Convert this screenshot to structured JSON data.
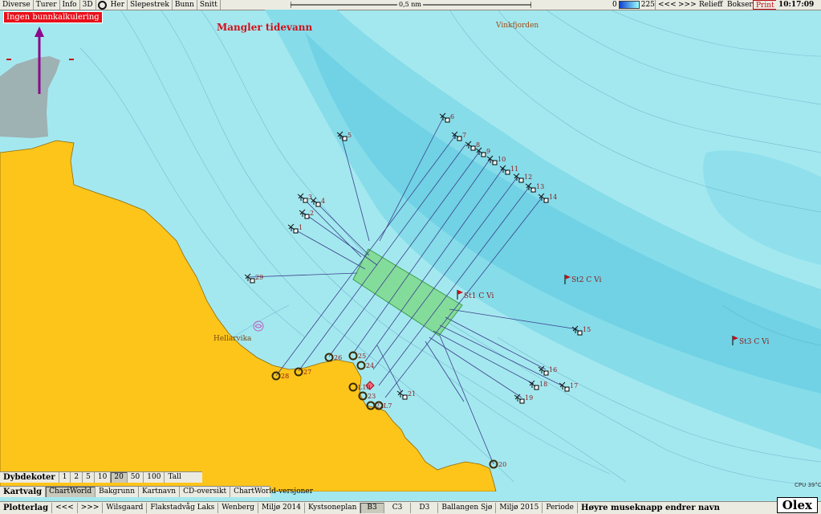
{
  "topbar": {
    "buttons": [
      "Diverse",
      "Turer",
      "Info",
      "3D",
      "Her",
      "Slepestrek",
      "Bunn",
      "Snitt"
    ],
    "scale_label": "0,5 nm",
    "depth_min": "0",
    "depth_max": "2250",
    "nav_back": "<<<",
    "nav_fwd": ">>>",
    "relieff": "Relieff",
    "bokser": "Bokser",
    "print": "Print",
    "clock": "10:17:09"
  },
  "map": {
    "warning_label": "Ingen bunnkalkulering",
    "tide_warning": "Mangler tidevann",
    "place_vinkfjorden": "Vinkfjorden",
    "place_hellarvika": "Hellarvika",
    "stations": [
      {
        "name": "St1 C Vi"
      },
      {
        "name": "St2 C Vi"
      },
      {
        "name": "St3 C Vi"
      }
    ],
    "marks": [
      "1",
      "2",
      "3",
      "4",
      "5",
      "6",
      "7",
      "8",
      "9",
      "10",
      "11",
      "12",
      "13",
      "14",
      "15",
      "16",
      "17",
      "18",
      "19",
      "20",
      "21",
      "22",
      "23",
      "24",
      "25",
      "26",
      "27",
      "28",
      "29",
      "L10",
      "L7"
    ],
    "cpu": "CPU 39°C"
  },
  "dybdekoter": {
    "title": "Dybdekoter",
    "options": [
      "1",
      "2",
      "5",
      "10",
      "20",
      "50",
      "100",
      "Tall"
    ],
    "selected": "20"
  },
  "kartvalg": {
    "title": "Kartvalg",
    "options": [
      "ChartWorld",
      "Bakgrunn",
      "Kartnavn",
      "CD-oversikt",
      "ChartWorld-versjoner"
    ],
    "selected": "ChartWorld"
  },
  "plotterlag": {
    "title": "Plotterlag",
    "nav_back": "<<<",
    "nav_fwd": ">>>",
    "options": [
      "Wilsgaard",
      "Flakstadvåg Laks",
      "Wenberg",
      "Miljø 2014",
      "Kystsoneplan",
      "B3",
      "C3",
      "D3",
      "Ballangen Sjø",
      "Miljø 2015",
      "Periode"
    ],
    "selected": "B3",
    "hint": "Høyre museknapp endrer navn"
  },
  "brand": "Olex",
  "colors": {
    "water": "#a4e8ef",
    "deep": "#6fd6e6",
    "land": "#fdc51a",
    "area": "#7fd98c",
    "track": "#3a3f8c",
    "mark": "#8b1a1a",
    "marker_warn": "#e8101a"
  }
}
